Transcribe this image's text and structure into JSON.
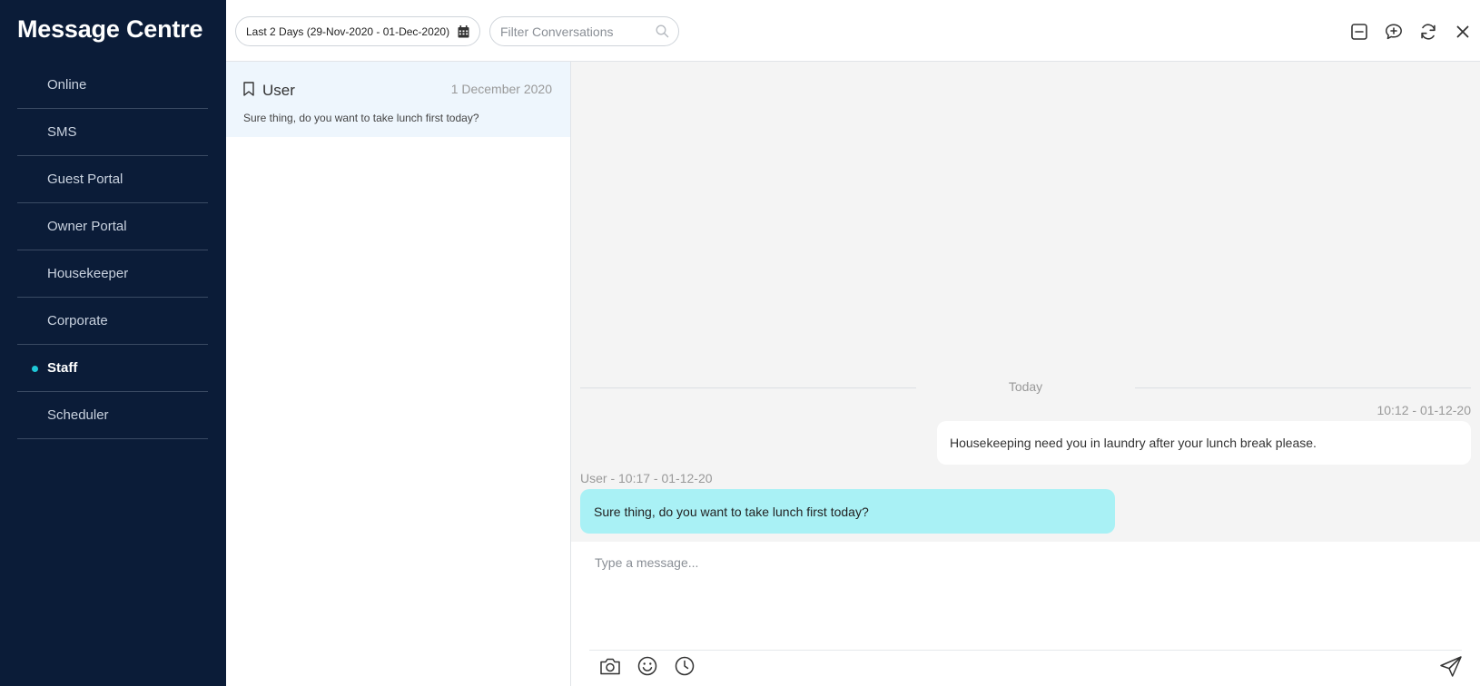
{
  "app": {
    "title": "Message Centre"
  },
  "sidebar": {
    "items": [
      {
        "label": "Online",
        "active": false
      },
      {
        "label": "SMS",
        "active": false
      },
      {
        "label": "Guest Portal",
        "active": false
      },
      {
        "label": "Owner Portal",
        "active": false
      },
      {
        "label": "Housekeeper",
        "active": false
      },
      {
        "label": "Corporate",
        "active": false
      },
      {
        "label": "Staff",
        "active": true
      },
      {
        "label": "Scheduler",
        "active": false
      }
    ]
  },
  "topbar": {
    "date_range": "Last 2 Days (29-Nov-2020 - 01-Dec-2020)",
    "filter_placeholder": "Filter Conversations",
    "icons": [
      "collapse-icon",
      "new-conversation-icon",
      "refresh-icon",
      "close-icon"
    ]
  },
  "conversations": [
    {
      "name": "User",
      "date": "1 December 2020",
      "preview": "Sure thing, do you want to take lunch first today?"
    }
  ],
  "chat": {
    "day_label": "Today",
    "messages": [
      {
        "direction": "out",
        "meta": "10:12 - 01-12-20",
        "text": "Housekeeping need you in laundry after your lunch break please."
      },
      {
        "direction": "in",
        "meta": "User - 10:17 - 01-12-20",
        "text": "Sure thing, do you want to take lunch first today?"
      }
    ]
  },
  "composer": {
    "placeholder": "Type a message...",
    "tools": [
      "camera-icon",
      "emoji-icon",
      "clock-icon",
      "send-icon"
    ]
  },
  "colors": {
    "sidebar_bg": "#0b1c38",
    "accent": "#1fc8d8",
    "incoming_bubble": "#a9f1f5",
    "selected_conversation": "#eef6fd",
    "chat_bg": "#f4f4f4"
  }
}
